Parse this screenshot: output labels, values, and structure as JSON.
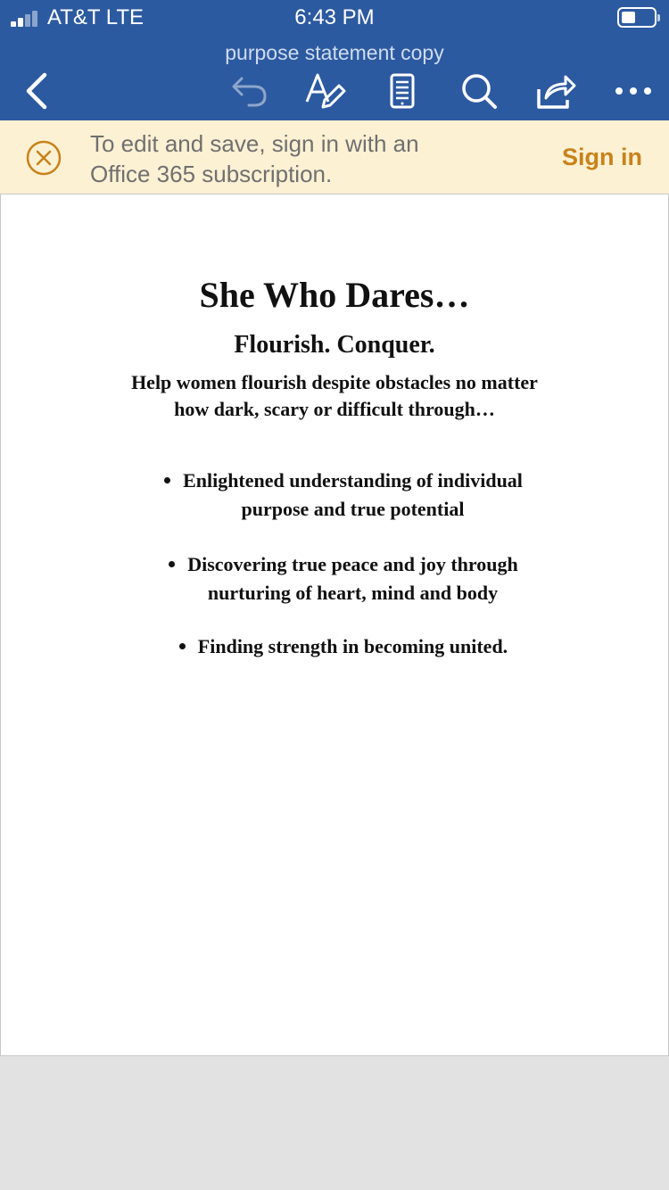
{
  "status_bar": {
    "carrier": "AT&T  LTE",
    "time": "6:43 PM",
    "signal_bars_active": 2,
    "signal_bars_total": 4
  },
  "toolbar": {
    "doc_title": "purpose statement copy",
    "icons": [
      "back-icon",
      "undo-icon",
      "text-edit-icon",
      "mobile-view-icon",
      "search-icon",
      "share-icon",
      "more-icon"
    ]
  },
  "banner": {
    "line1": "To edit and save, sign in with an",
    "line2": "Office 365 subscription.",
    "action": "Sign in",
    "accent_color": "#c8821b",
    "background": "#fcf1d3"
  },
  "document": {
    "title": "She Who Dares…",
    "subtitle": "Flourish. Conquer.",
    "intro_line1": "Help women flourish despite obstacles no matter",
    "intro_line2": "how dark, scary or difficult through…",
    "bullets": [
      {
        "line1": "Enlightened understanding of individual",
        "line2": "purpose and true potential"
      },
      {
        "line1": "Discovering true peace and joy through",
        "line2": "nurturing of heart, mind and body"
      },
      {
        "line1": "Finding strength in becoming united.",
        "line2": ""
      }
    ]
  },
  "colors": {
    "header": "#2c5aa0",
    "page_background": "#ffffff",
    "canvas_background": "#e2e2e2"
  }
}
